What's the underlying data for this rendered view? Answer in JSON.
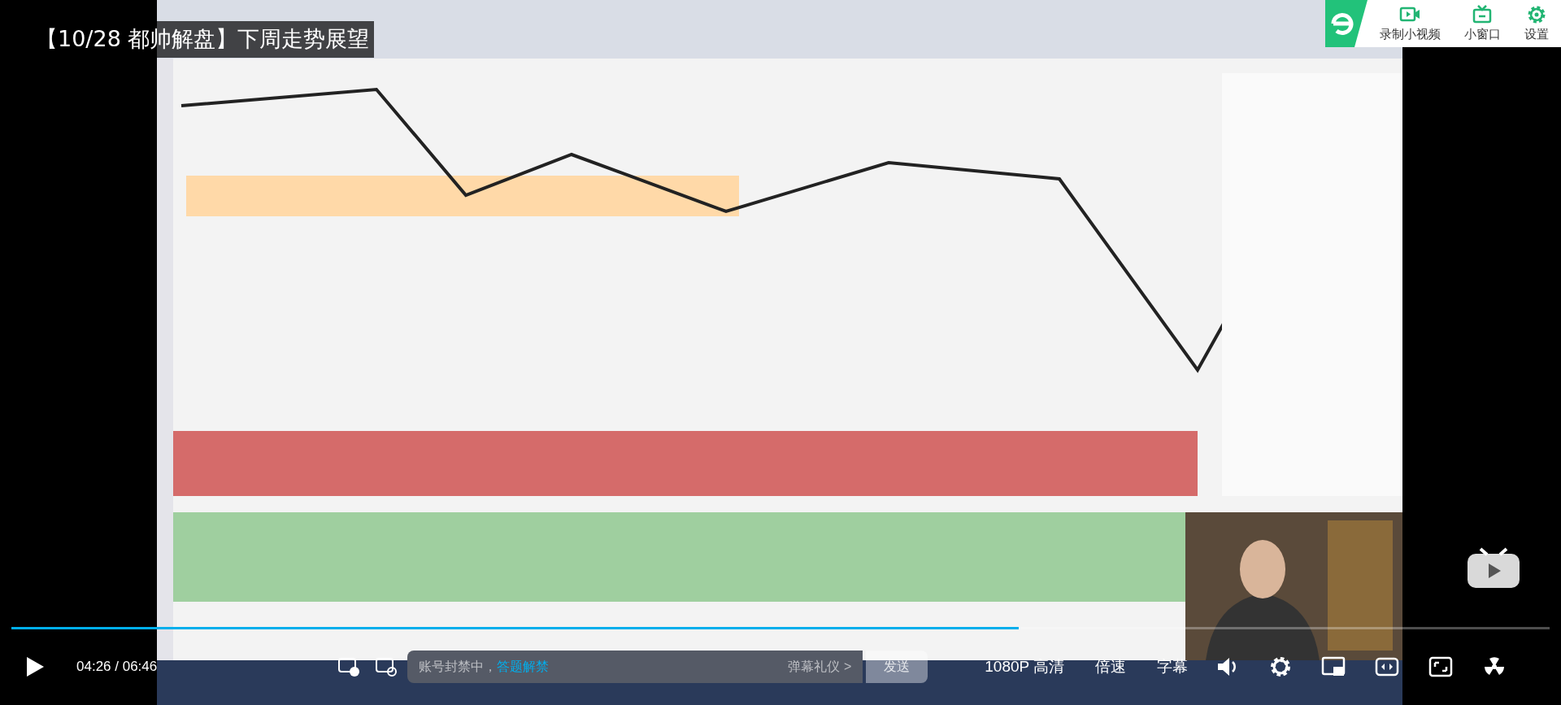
{
  "video": {
    "title": "【10/28 都帅解盘】下周走势展望"
  },
  "top_panel": {
    "items": [
      {
        "label": "录制小视频",
        "kind": "record"
      },
      {
        "label": "小窗口",
        "kind": "tv"
      },
      {
        "label": "设置",
        "kind": "gear"
      }
    ]
  },
  "progress": {
    "level": 0.655
  },
  "controls": {
    "time": "04:26 / 06:46",
    "danmaku_input": {
      "placeholder": "账号封禁中，",
      "link": "答题解禁",
      "etiquette": "弹幕礼仪 >",
      "send": "发送"
    },
    "buttons": [
      {
        "label": "1080P 高清"
      },
      {
        "label": "倍速"
      },
      {
        "label": "字幕"
      }
    ]
  }
}
